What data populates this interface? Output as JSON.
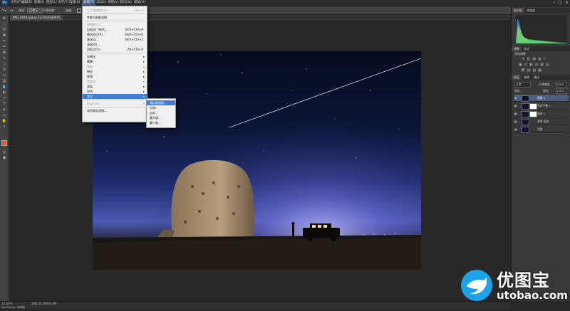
{
  "app": {
    "logo": "Ps"
  },
  "menubar": {
    "items": [
      "文件(F)",
      "编辑(E)",
      "图像(I)",
      "图层(L)",
      "文字(Y)",
      "选择(S)",
      "滤镜(T)",
      "3D(D)",
      "视图(V)",
      "窗口(W)",
      "帮助(H)"
    ],
    "active_index": 6,
    "window_buttons": [
      "–",
      "□",
      "✕"
    ]
  },
  "optionsbar": {
    "mode_label": "模式:",
    "opacity_label": "不透明度:",
    "flow_label": "流量:",
    "checkbox_label": "对所有图层取样",
    "right_button": "基本功能"
  },
  "document": {
    "tab_label": "IMG_XXXX.jpg @ 33.3%(RGB/8#)",
    "zoom": "33.33%",
    "doc_info": "文档:34.3M/34.3M"
  },
  "status": {
    "mini_bridge": "Mini Bridge",
    "timeline": "时间轴"
  },
  "filter_menu": {
    "items": [
      {
        "label": "上次滤镜操作(F)",
        "shortcut": "Ctrl+F",
        "disabled": true
      },
      {
        "sep": true
      },
      {
        "label": "转换为智能滤镜",
        "shortcut": ""
      },
      {
        "sep": true
      },
      {
        "label": "滤镜库(G)...",
        "shortcut": "",
        "disabled": true
      },
      {
        "label": "自适应广角(A)...",
        "shortcut": "Shift+Ctrl+A"
      },
      {
        "label": "镜头校正(R)...",
        "shortcut": "Shift+Ctrl+R"
      },
      {
        "label": "液化(L)...",
        "shortcut": "Shift+Ctrl+X"
      },
      {
        "label": "油画(O)...",
        "shortcut": ""
      },
      {
        "label": "消失点(V)...",
        "shortcut": "Alt+Ctrl+V"
      },
      {
        "sep": true
      },
      {
        "label": "风格化",
        "submenu": true
      },
      {
        "label": "模糊",
        "submenu": true
      },
      {
        "label": "扭曲",
        "submenu": true,
        "disabled": true
      },
      {
        "label": "锐化",
        "submenu": true
      },
      {
        "label": "视频",
        "submenu": true
      },
      {
        "label": "素描化",
        "submenu": true,
        "disabled": true
      },
      {
        "label": "渲染",
        "submenu": true
      },
      {
        "label": "杂色",
        "submenu": true
      },
      {
        "label": "其它",
        "submenu": true,
        "highlighted": true
      },
      {
        "sep": true
      },
      {
        "label": "Digimarc",
        "submenu": true,
        "disabled": true
      },
      {
        "sep": true
      },
      {
        "label": "浏览联机滤镜...",
        "shortcut": ""
      }
    ]
  },
  "other_submenu": {
    "items": [
      {
        "label": "高反差保留...",
        "highlighted": true
      },
      {
        "label": "位移..."
      },
      {
        "label": "自定..."
      },
      {
        "label": "最大值..."
      },
      {
        "label": "最小值..."
      }
    ]
  },
  "panels": {
    "histogram_tabs": [
      "直方图",
      "导航器"
    ],
    "adjust_tabs": [
      "调整",
      "样式"
    ],
    "adjust_title": "添加调整",
    "layers_tabs": [
      "图层",
      "通道",
      "路径"
    ],
    "blend_mode": "正常",
    "opacity_label": "不透明度:",
    "opacity_value": "100%",
    "lock_label": "锁定:",
    "fill_label": "填充:",
    "fill_value": "100%",
    "layers": [
      {
        "name": "图层 1",
        "selected": true,
        "mask": false
      },
      {
        "name": "色彩平衡 1",
        "selected": false,
        "mask": true
      },
      {
        "name": "曲线 1",
        "selected": false,
        "mask": true
      },
      {
        "name": "背景 副本",
        "selected": false,
        "mask": false
      },
      {
        "name": "背景",
        "selected": false,
        "mask": false
      }
    ]
  },
  "watermark": {
    "brand": "优图宝",
    "url": "utobao.com"
  },
  "colors": {
    "menu_highlight": "#3f7dd6",
    "layer_selected": "#4b5e7f",
    "fg_color": "#d25a2c"
  }
}
